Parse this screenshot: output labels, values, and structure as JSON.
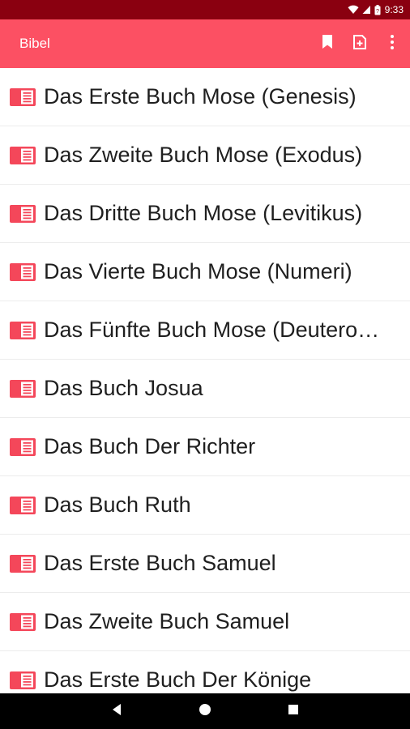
{
  "status_bar": {
    "time": "9:33",
    "icons": [
      "wifi-icon",
      "signal-icon",
      "battery-icon"
    ]
  },
  "toolbar": {
    "title": "Bibel",
    "actions": [
      "bookmark-icon",
      "add-note-icon",
      "more-vert-icon"
    ]
  },
  "colors": {
    "status_bar": "#8a0010",
    "toolbar": "#fc5063",
    "icon_accent": "#f4475a",
    "nav_bar": "#000000"
  },
  "books": [
    {
      "label": "Das Erste Buch Mose (Genesis)"
    },
    {
      "label": "Das Zweite Buch Mose (Exodus)"
    },
    {
      "label": "Das Dritte Buch Mose (Levitikus)"
    },
    {
      "label": "Das Vierte Buch Mose (Numeri)"
    },
    {
      "label": "Das Fünfte Buch Mose (Deutero…"
    },
    {
      "label": "Das Buch Josua"
    },
    {
      "label": "Das Buch Der Richter"
    },
    {
      "label": "Das Buch Ruth"
    },
    {
      "label": "Das Erste Buch Samuel"
    },
    {
      "label": "Das Zweite Buch Samuel"
    },
    {
      "label": "Das Erste Buch Der Könige"
    }
  ],
  "nav_bar": {
    "buttons": [
      "back-icon",
      "home-icon",
      "recents-icon"
    ]
  }
}
